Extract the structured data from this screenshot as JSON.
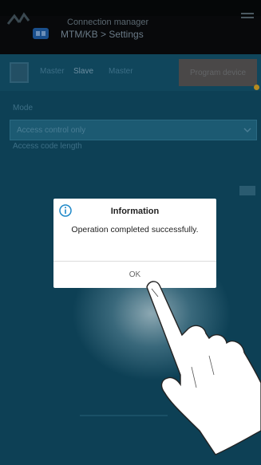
{
  "header": {
    "connection_title": "Connection manager",
    "breadcrumb": "MTM/KB > Settings"
  },
  "settings": {
    "tab_left": "Master",
    "tab_active": "Slave",
    "tab_right": "Master",
    "program_button": "Program device",
    "mode_label": "Mode",
    "mode_value": "Access control only",
    "access_code_length_label": "Access code length"
  },
  "dialog": {
    "title": "Information",
    "message": "Operation completed successfully.",
    "ok_label": "OK",
    "icon": "info-icon"
  },
  "colors": {
    "background": "#0d4055",
    "dialog": "#ffffff",
    "info_icon": "#1e88c8"
  }
}
